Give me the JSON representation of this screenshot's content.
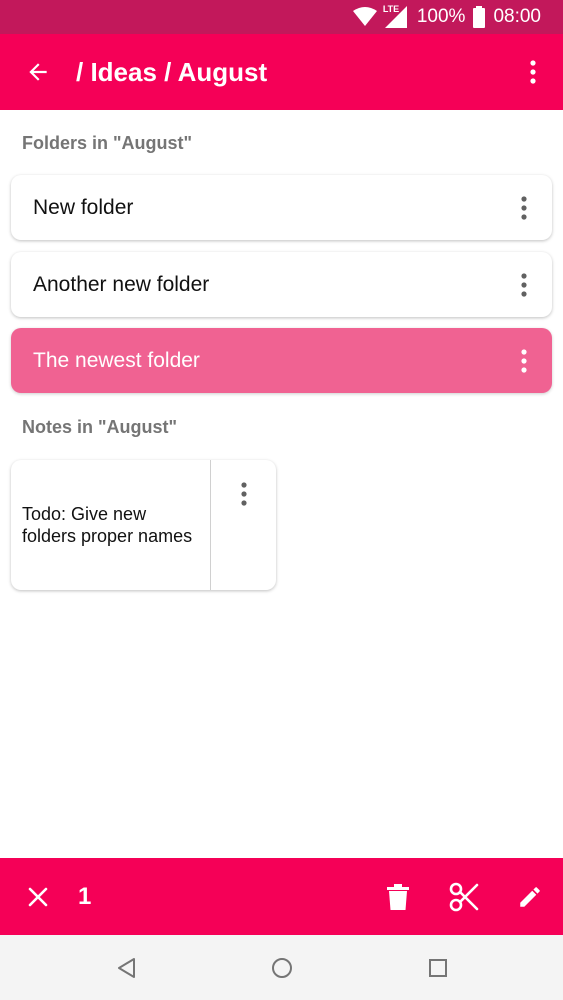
{
  "status_bar": {
    "network": "LTE",
    "battery": "100%",
    "time": "08:00"
  },
  "app_bar": {
    "title": "/ Ideas / August"
  },
  "folders_section": {
    "header": "Folders in \"August\"",
    "items": [
      {
        "label": "New folder",
        "selected": false
      },
      {
        "label": "Another new folder",
        "selected": false
      },
      {
        "label": "The newest folder",
        "selected": true
      }
    ]
  },
  "notes_section": {
    "header": "Notes in \"August\"",
    "items": [
      {
        "text": "Todo: Give new folders proper names"
      }
    ]
  },
  "selection_bar": {
    "count": "1"
  },
  "colors": {
    "status_bar": "#c2185b",
    "primary": "#f50057",
    "selected_item": "#f06292",
    "section_header": "#757575"
  },
  "icons": [
    "wifi-icon",
    "lte-signal-icon",
    "battery-icon",
    "back-arrow-icon",
    "more-vert-icon",
    "close-icon",
    "delete-icon",
    "cut-icon",
    "edit-icon",
    "nav-back-icon",
    "nav-home-icon",
    "nav-recents-icon"
  ]
}
